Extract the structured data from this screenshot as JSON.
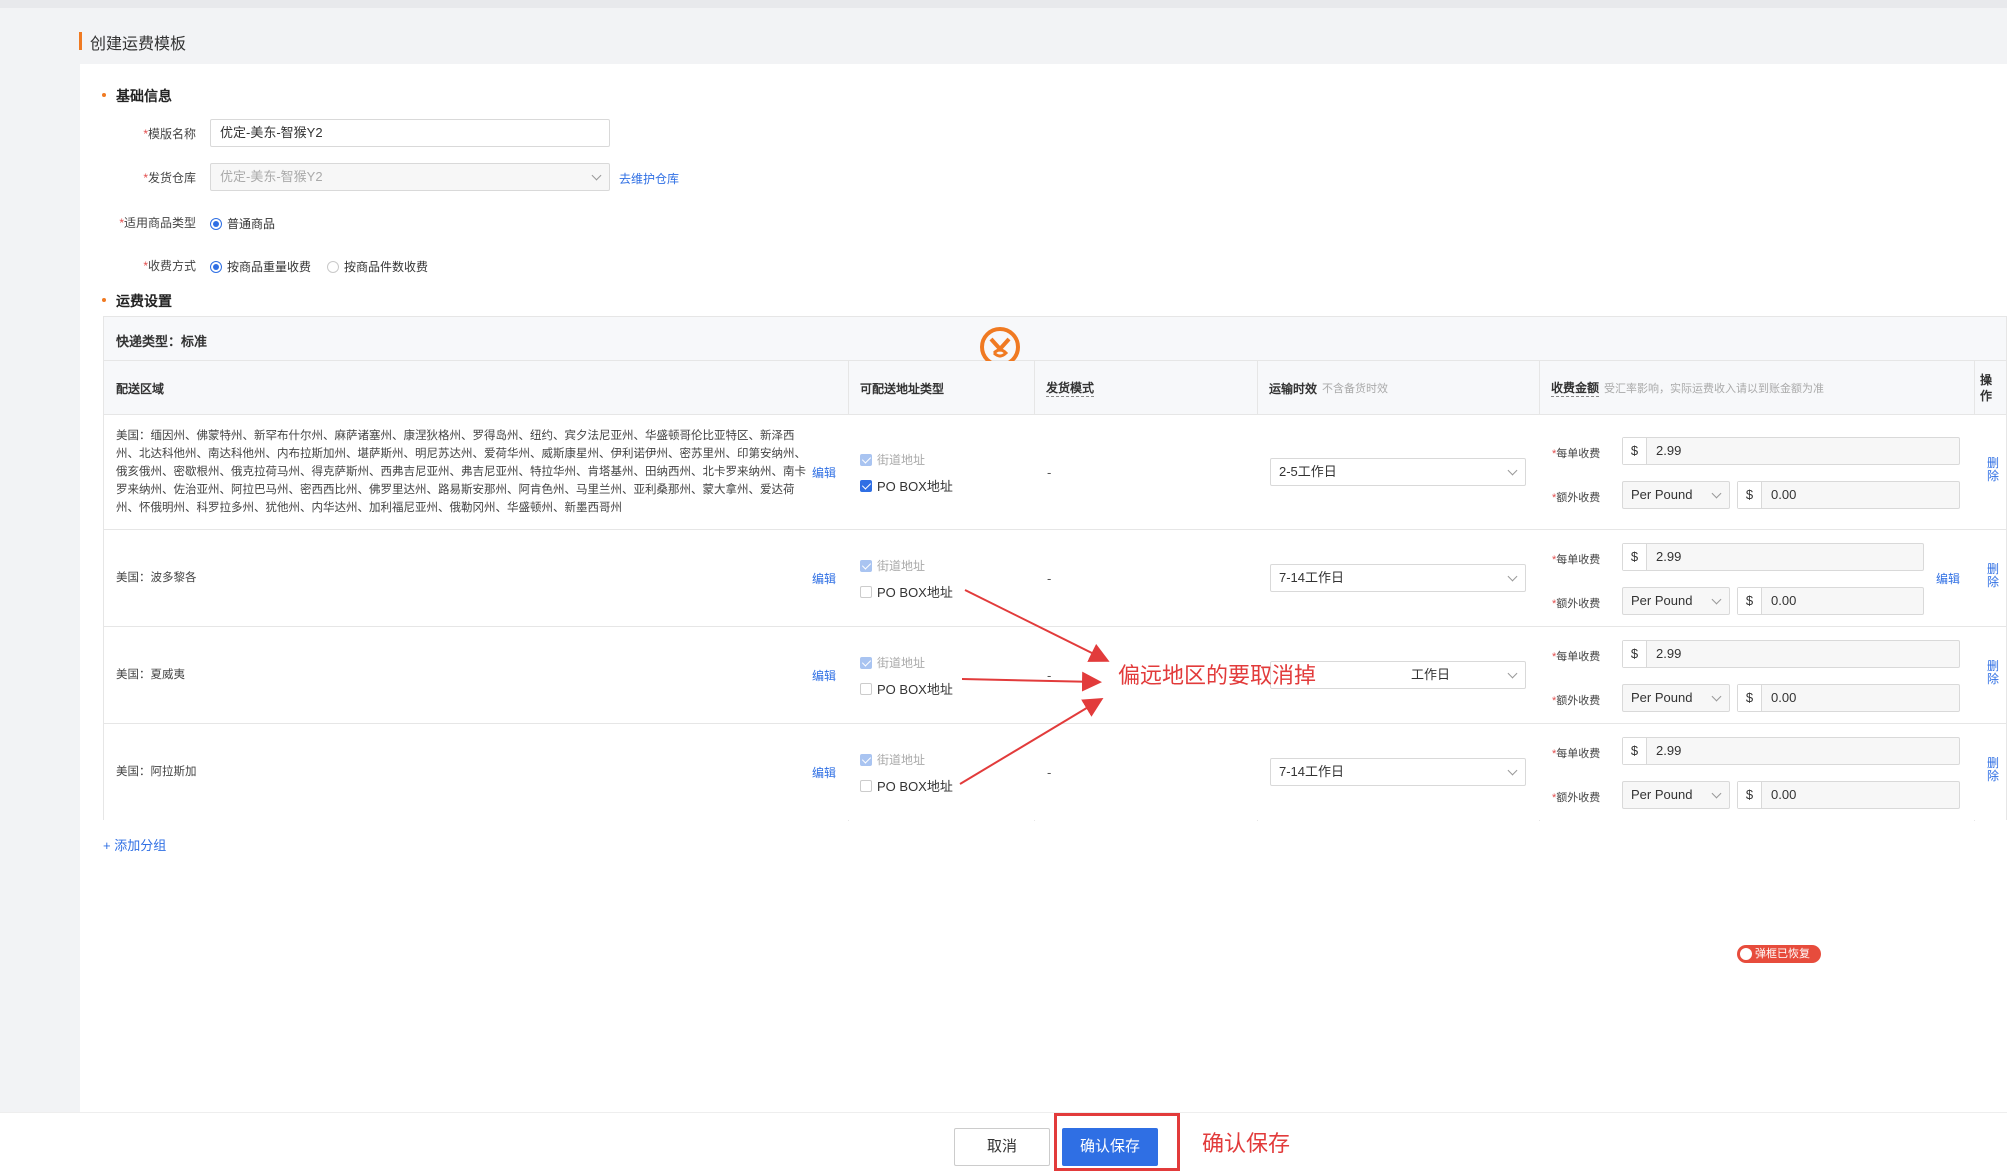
{
  "page": {
    "title": "创建运费模板"
  },
  "basic": {
    "heading": "基础信息",
    "template_name_label": "模版名称",
    "template_name_value": "优定-美东-智猴Y2",
    "warehouse_label": "发货仓库",
    "warehouse_value": "优定-美东-智猴Y2",
    "maintain_link": "去维护仓库",
    "goods_type_label": "适用商品类型",
    "goods_type_option": "普通商品",
    "charge_label": "收费方式",
    "charge_options": [
      "按商品重量收费",
      "按商品件数收费"
    ],
    "charge_selected": "按商品重量收费"
  },
  "freight": {
    "heading": "运费设置",
    "express_type": "快递类型：标准",
    "columns": {
      "region": "配送区域",
      "address_type": "可配送地址类型",
      "ship_mode": "发货模式",
      "transit": "运输时效",
      "transit_sub": "不含备货时效",
      "fee": "收费金额",
      "fee_sub": "受汇率影响，实际运费收入请以到账金额为准",
      "op": "操作"
    },
    "rows": [
      {
        "region": "美国：缅因州、佛蒙特州、新罕布什尔州、麻萨诸塞州、康涅狄格州、罗得岛州、纽约、宾夕法尼亚州、华盛顿哥伦比亚特区、新泽西州、北达科他州、南达科他州、内布拉斯加州、堪萨斯州、明尼苏达州、爱荷华州、威斯康星州、伊利诺伊州、密苏里州、印第安纳州、俄亥俄州、密歇根州、俄克拉荷马州、得克萨斯州、西弗吉尼亚州、弗吉尼亚州、特拉华州、肯塔基州、田纳西州、北卡罗来纳州、南卡罗来纳州、佐治亚州、阿拉巴马州、密西西比州、佛罗里达州、路易斯安那州、阿肯色州、马里兰州、亚利桑那州、蒙大拿州、爱达荷州、怀俄明州、科罗拉多州、犹他州、内华达州、加利福尼亚州、俄勒冈州、华盛顿州、新墨西哥州",
        "edit": "编辑",
        "street": "街道地址",
        "pobox": "PO BOX地址",
        "pobox_checked": true,
        "mode": "-",
        "transit": "2-5工作日",
        "per_order_label": "每单收费",
        "per_order_cur": "$",
        "per_order": "2.99",
        "extra_label": "额外收费",
        "extra_unit": "Per Pound",
        "extra_cur": "$",
        "extra": "0.00",
        "delete": "删除"
      },
      {
        "region": "美国：波多黎各",
        "edit": "编辑",
        "street": "街道地址",
        "pobox": "PO BOX地址",
        "pobox_checked": false,
        "mode": "-",
        "transit": "7-14工作日",
        "per_order_label": "每单收费",
        "per_order_cur": "$",
        "per_order": "2.99",
        "extra_label": "额外收费",
        "extra_unit": "Per Pound",
        "extra_cur": "$",
        "extra": "0.00",
        "fee_edit": "编辑",
        "delete": "删除"
      },
      {
        "region": "美国：夏威夷",
        "edit": "编辑",
        "street": "街道地址",
        "pobox": "PO BOX地址",
        "pobox_checked": false,
        "mode": "-",
        "transit": "工作日",
        "per_order_label": "每单收费",
        "per_order_cur": "$",
        "per_order": "2.99",
        "extra_label": "额外收费",
        "extra_unit": "Per Pound",
        "extra_cur": "$",
        "extra": "0.00",
        "delete": "删除"
      },
      {
        "region": "美国：阿拉斯加",
        "edit": "编辑",
        "street": "街道地址",
        "pobox": "PO BOX地址",
        "pobox_checked": false,
        "mode": "-",
        "transit": "7-14工作日",
        "per_order_label": "每单收费",
        "per_order_cur": "$",
        "per_order": "2.99",
        "extra_label": "额外收费",
        "extra_unit": "Per Pound",
        "extra_cur": "$",
        "extra": "0.00",
        "delete": "删除"
      }
    ],
    "add_group": "+ 添加分组"
  },
  "toast": "弹框已恢复",
  "footer": {
    "cancel": "取消",
    "save": "确认保存"
  },
  "annotations": {
    "remote": "偏远地区的要取消掉",
    "save": "确认保存"
  },
  "colors": {
    "accent": "#2f6fe4",
    "brand_orange": "#f07a22",
    "annotation_red": "#e23b3b"
  }
}
